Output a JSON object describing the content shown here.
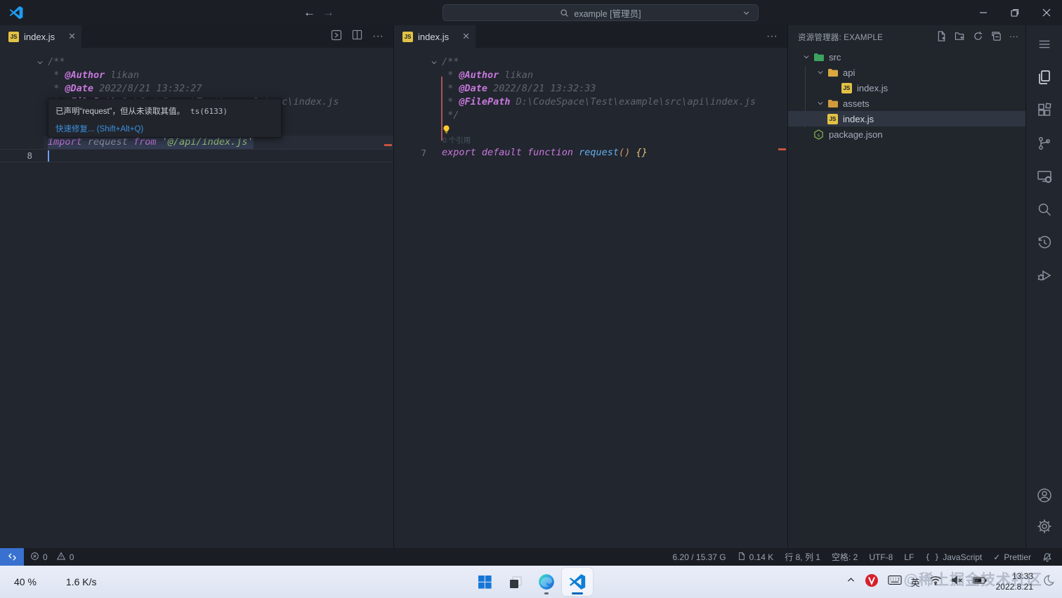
{
  "colors": {
    "accent_blue": "#3c8fe0",
    "remote_bg": "#3871cf",
    "keyword_purple": "#c678dd",
    "string_green": "#98c379",
    "function_blue": "#61afef",
    "js_badge_yellow": "#e2c245",
    "taskbar_active_underline": "#0067c0",
    "overview_marker": "#c4543f"
  },
  "title_bar": {
    "search_label": "example [管理员]",
    "nav_icons": [
      "back-arrow",
      "forward-arrow"
    ],
    "window_icons": [
      "minimize",
      "restore",
      "close"
    ]
  },
  "left_group": {
    "tab": {
      "label": "index.js",
      "icon": "js-file-icon"
    },
    "action_icons": [
      "run-code",
      "split-editor",
      "more-actions"
    ],
    "tooltip": {
      "message": "已声明“request”，但从未读取其值。",
      "code": "ts(6133)",
      "quickfix": "快速修复... (Shift+Alt+Q)"
    },
    "lines": [
      {
        "num": "",
        "fold": true,
        "tokens": [
          [
            "c",
            "/**"
          ]
        ]
      },
      {
        "tokens": [
          [
            "c",
            " * "
          ],
          [
            "g",
            "@Author"
          ],
          [
            "v",
            " likan"
          ]
        ]
      },
      {
        "tokens": [
          [
            "c",
            " * "
          ],
          [
            "g",
            "@Date"
          ],
          [
            "v",
            " 2022/8/21 13:32:27"
          ]
        ]
      },
      {
        "tokens": [
          [
            "c",
            " * "
          ],
          [
            "g",
            "@FilePath"
          ],
          [
            "v",
            " D:\\CodeSpace\\Test\\example\\src\\index.js"
          ]
        ]
      },
      {
        "tokens": [
          [
            "c",
            " */"
          ]
        ]
      },
      {
        "tokens": []
      },
      {
        "selected": true,
        "tokens": [
          [
            "k",
            "import"
          ],
          [
            "p",
            " "
          ],
          [
            "i",
            "request"
          ],
          [
            "p",
            " "
          ],
          [
            "k",
            "from"
          ],
          [
            "p",
            " "
          ],
          [
            "s",
            "'@/api/index.js'"
          ]
        ]
      },
      {
        "num": "8",
        "current": true,
        "cursor": true,
        "tokens": []
      }
    ]
  },
  "right_group": {
    "tab": {
      "label": "index.js",
      "icon": "js-file-icon"
    },
    "action_icons": [
      "more-actions"
    ],
    "lines": [
      {
        "fold": true,
        "tokens": [
          [
            "c",
            "/**"
          ]
        ]
      },
      {
        "tokens": [
          [
            "c",
            " * "
          ],
          [
            "g",
            "@Author"
          ],
          [
            "v",
            " likan"
          ]
        ]
      },
      {
        "tokens": [
          [
            "c",
            " * "
          ],
          [
            "g",
            "@Date"
          ],
          [
            "v",
            " 2022/8/21 13:32:33"
          ]
        ]
      },
      {
        "tokens": [
          [
            "c",
            " * "
          ],
          [
            "g",
            "@FilePath"
          ],
          [
            "v",
            " D:\\CodeSpace\\Test\\example\\src\\api\\index.js"
          ]
        ]
      },
      {
        "tokens": [
          [
            "c",
            " */"
          ]
        ]
      },
      {
        "bulb": true,
        "tokens": []
      },
      {
        "codelens": "0 个引用"
      },
      {
        "num": "7",
        "tokens": [
          [
            "k",
            "export"
          ],
          [
            "p",
            " "
          ],
          [
            "k",
            "default"
          ],
          [
            "p",
            " "
          ],
          [
            "k",
            "function"
          ],
          [
            "p",
            " "
          ],
          [
            "f",
            "request"
          ],
          [
            "b1",
            "()"
          ],
          [
            "p",
            " "
          ],
          [
            "b2",
            "{}"
          ]
        ]
      }
    ]
  },
  "explorer": {
    "title": "资源管理器: EXAMPLE",
    "action_icons": [
      "new-file",
      "new-folder",
      "refresh",
      "collapse-all",
      "more-actions"
    ],
    "items": [
      {
        "label": "src",
        "depth": 0,
        "type": "folder-src",
        "expanded": true
      },
      {
        "label": "api",
        "depth": 1,
        "type": "folder",
        "expanded": true
      },
      {
        "label": "index.js",
        "depth": 2,
        "type": "js"
      },
      {
        "label": "assets",
        "depth": 1,
        "type": "folder-assets",
        "expanded": true
      },
      {
        "label": "index.js",
        "depth": 1,
        "type": "js",
        "selected": true
      },
      {
        "label": "package.json",
        "depth": 0,
        "type": "npm"
      }
    ]
  },
  "activity_bar": {
    "icons": [
      "menu",
      "explorer",
      "extensions",
      "source-control",
      "remote-explorer",
      "search",
      "history",
      "run-debug",
      "account",
      "settings"
    ]
  },
  "status_bar": {
    "errors": "0",
    "warnings": "0",
    "memory": "6.20 / 15.37 G",
    "file_size": "0.14 K",
    "cursor_position": "行 8, 列 1",
    "indent": "空格: 2",
    "encoding": "UTF-8",
    "eol": "LF",
    "language": "JavaScript",
    "formatter": "Prettier"
  },
  "taskbar": {
    "cpu": "40 %",
    "net": "1.6 K/s",
    "center_icons": [
      "windows-start",
      "task-view",
      "edge-browser",
      "vscode"
    ],
    "tray_icons": [
      "chevron-up",
      "v2ray",
      "keyboard",
      "ime",
      "wifi",
      "volume-muted",
      "battery",
      "night-mode"
    ],
    "ime": "英",
    "clock_time": "13:33",
    "clock_date": "2022.8.21",
    "watermark": "@稀土掘金技术社区"
  }
}
